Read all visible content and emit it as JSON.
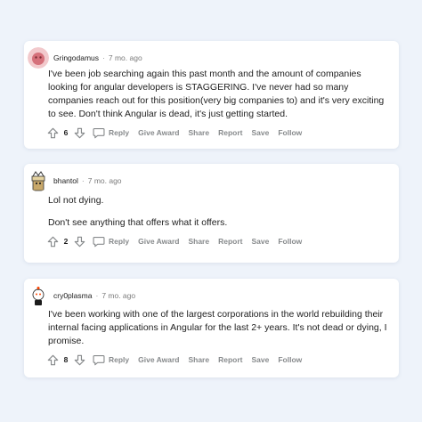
{
  "comments": [
    {
      "username": "Gringodamus",
      "separator": "·",
      "time": "7 mo. ago",
      "paragraphs": [
        "I've been job searching again this past month and the amount of companies looking for angular developers is STAGGERING. I've never had so many companies reach out for this position(very big companies to) and it's very exciting to see. Don't think Angular is dead, it's just getting started."
      ],
      "score": "6"
    },
    {
      "username": "bhantol",
      "separator": "·",
      "time": "7 mo. ago",
      "paragraphs": [
        "Lol not dying.",
        "Don't see anything that offers what it offers."
      ],
      "score": "2"
    },
    {
      "username": "cry0plasma",
      "separator": "·",
      "time": "7 mo. ago",
      "paragraphs": [
        "I've been working with one of the largest corporations in the world rebuilding their internal facing applications in Angular for the last 2+ years. It's not dead or dying, I promise."
      ],
      "score": "8"
    }
  ],
  "actions": {
    "reply": "Reply",
    "give_award": "Give Award",
    "share": "Share",
    "report": "Report",
    "save": "Save",
    "follow": "Follow"
  },
  "icons": {
    "upvote": "upvote-arrow-icon",
    "downvote": "downvote-arrow-icon",
    "reply": "comment-bubble-icon"
  },
  "colors": {
    "background": "#eef3fa",
    "card": "#ffffff",
    "action_text": "#878a8c",
    "body_text": "#222222"
  }
}
